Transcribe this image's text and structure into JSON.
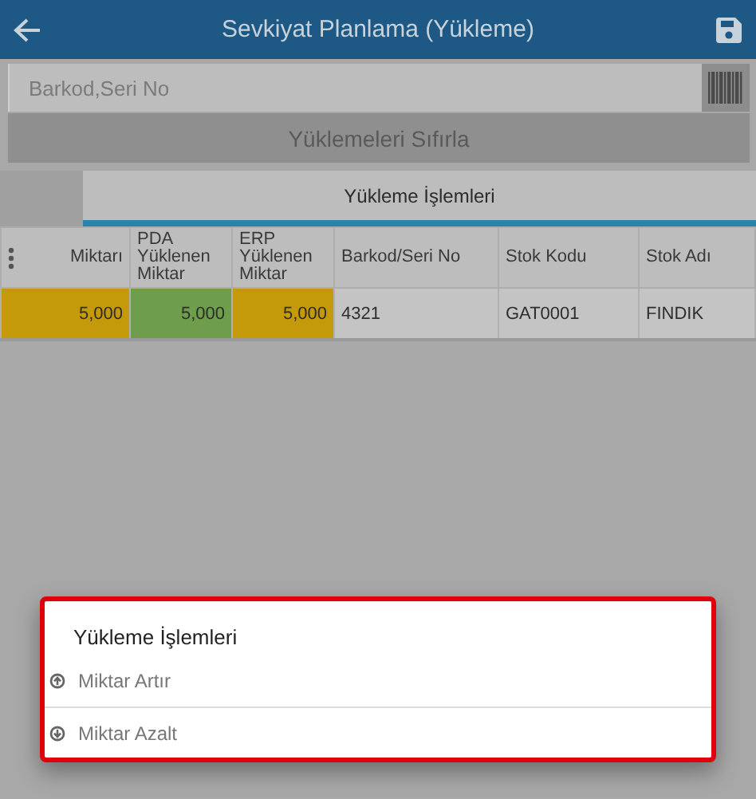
{
  "header": {
    "title": "Sevkiyat Planlama (Yükleme)"
  },
  "search": {
    "placeholder": "Barkod,Seri No"
  },
  "reset_button": "Yüklemeleri Sıfırla",
  "tabs": [
    {
      "label": "Yükleme İşlemleri",
      "selected": true
    }
  ],
  "table": {
    "columns": [
      "Miktarı",
      "PDA Yüklenen Miktar",
      "ERP Yüklenen Miktar",
      "Barkod/Seri No",
      "Stok Kodu",
      "Stok Adı"
    ],
    "rows": [
      {
        "cells": [
          {
            "text": "5,000",
            "color": "#c49a0a",
            "kind": "number"
          },
          {
            "text": "5,000",
            "color": "#6e9d4c",
            "kind": "number"
          },
          {
            "text": "5,000",
            "color": "#c49a0a",
            "kind": "number"
          },
          {
            "text": "4321",
            "kind": "text"
          },
          {
            "text": "GAT0001",
            "kind": "text"
          },
          {
            "text": "FINDIK",
            "kind": "text"
          }
        ]
      }
    ]
  },
  "popup": {
    "title": "Yükleme İşlemleri",
    "items": [
      {
        "label": "Miktar Artır",
        "kind": "increase"
      },
      {
        "label": "Miktar Azalt",
        "kind": "decrease"
      }
    ]
  }
}
